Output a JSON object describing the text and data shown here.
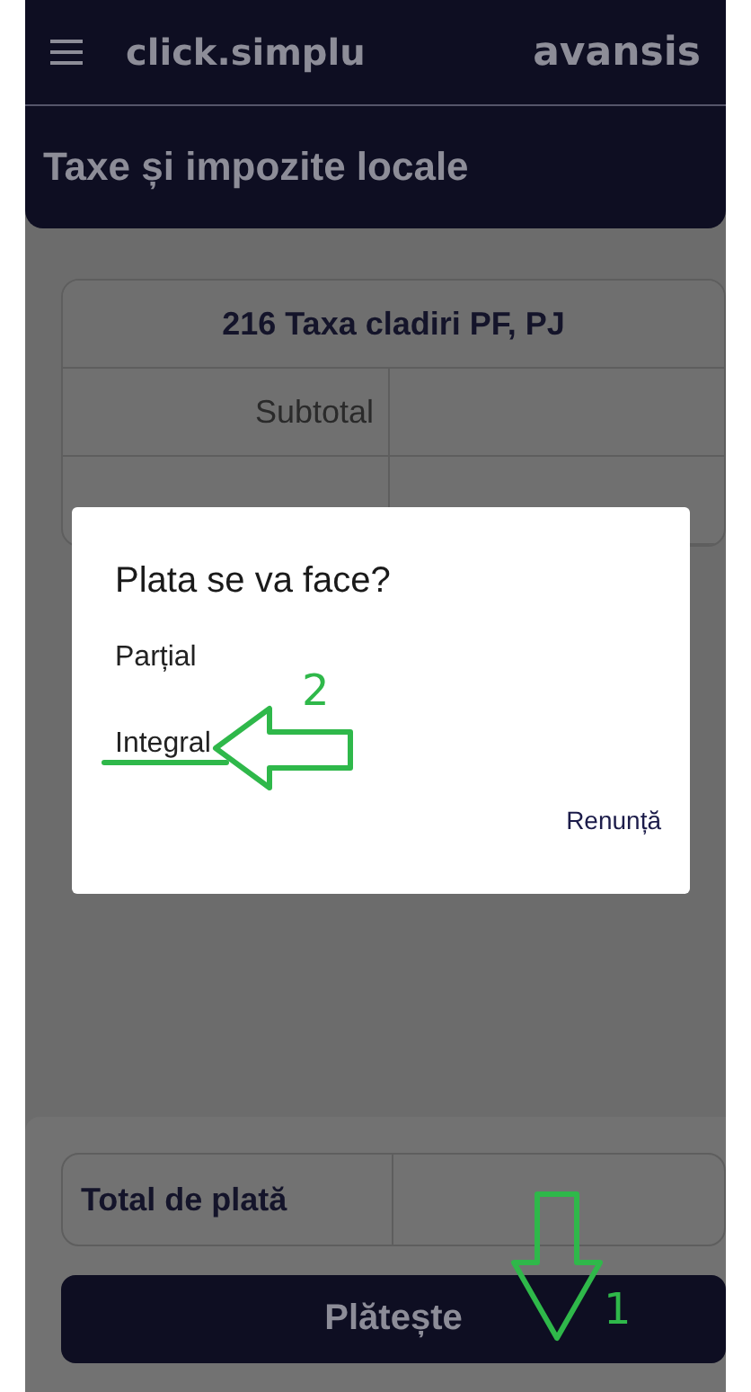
{
  "app_bar": {
    "brand": "click.simplu",
    "partner": "avansis"
  },
  "page_title": "Taxe și impozite locale",
  "card": {
    "title": "216 Taxa cladiri PF, PJ",
    "rows": [
      {
        "label": "Subtotal"
      }
    ]
  },
  "dialog": {
    "title": "Plata se va face?",
    "options": [
      "Parțial",
      "Integral"
    ],
    "cancel": "Renunță"
  },
  "total": {
    "label": "Total de plată"
  },
  "pay_button": "Plătește",
  "annotations": [
    {
      "kind": "arrow-left",
      "label": "2"
    },
    {
      "kind": "arrow-down",
      "label": "1"
    }
  ]
}
